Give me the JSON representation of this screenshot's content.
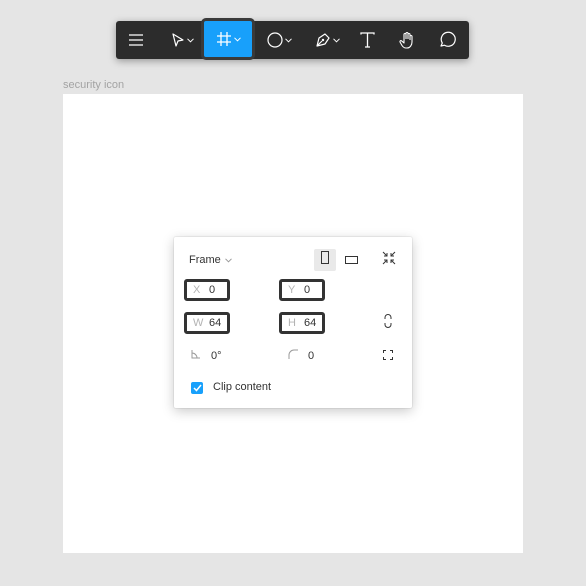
{
  "toolbar": {
    "tools": [
      {
        "name": "main-menu",
        "icon": "hamburger-menu-icon"
      },
      {
        "name": "move-tool",
        "icon": "cursor-arrow-icon",
        "has_dropdown": true
      },
      {
        "name": "frame-tool",
        "icon": "frame-hash-icon",
        "has_dropdown": true,
        "active": true
      },
      {
        "name": "shape-tool",
        "icon": "ellipse-icon",
        "has_dropdown": true
      },
      {
        "name": "pen-tool",
        "icon": "pen-icon",
        "has_dropdown": true
      },
      {
        "name": "text-tool",
        "icon": "text-icon"
      },
      {
        "name": "hand-tool",
        "icon": "hand-icon"
      },
      {
        "name": "comment-tool",
        "icon": "comment-bubble-icon"
      }
    ],
    "active_color": "#18a0fb",
    "background_color": "#2c2c2c"
  },
  "canvas": {
    "frame_label": "security icon"
  },
  "panel": {
    "title": "Frame",
    "x": {
      "label": "X",
      "value": "0"
    },
    "y": {
      "label": "Y",
      "value": "0"
    },
    "w": {
      "label": "W",
      "value": "64"
    },
    "h": {
      "label": "H",
      "value": "64"
    },
    "rotation": "0°",
    "corner_radius": "0",
    "clip_content": {
      "label": "Clip content",
      "checked": true
    }
  }
}
